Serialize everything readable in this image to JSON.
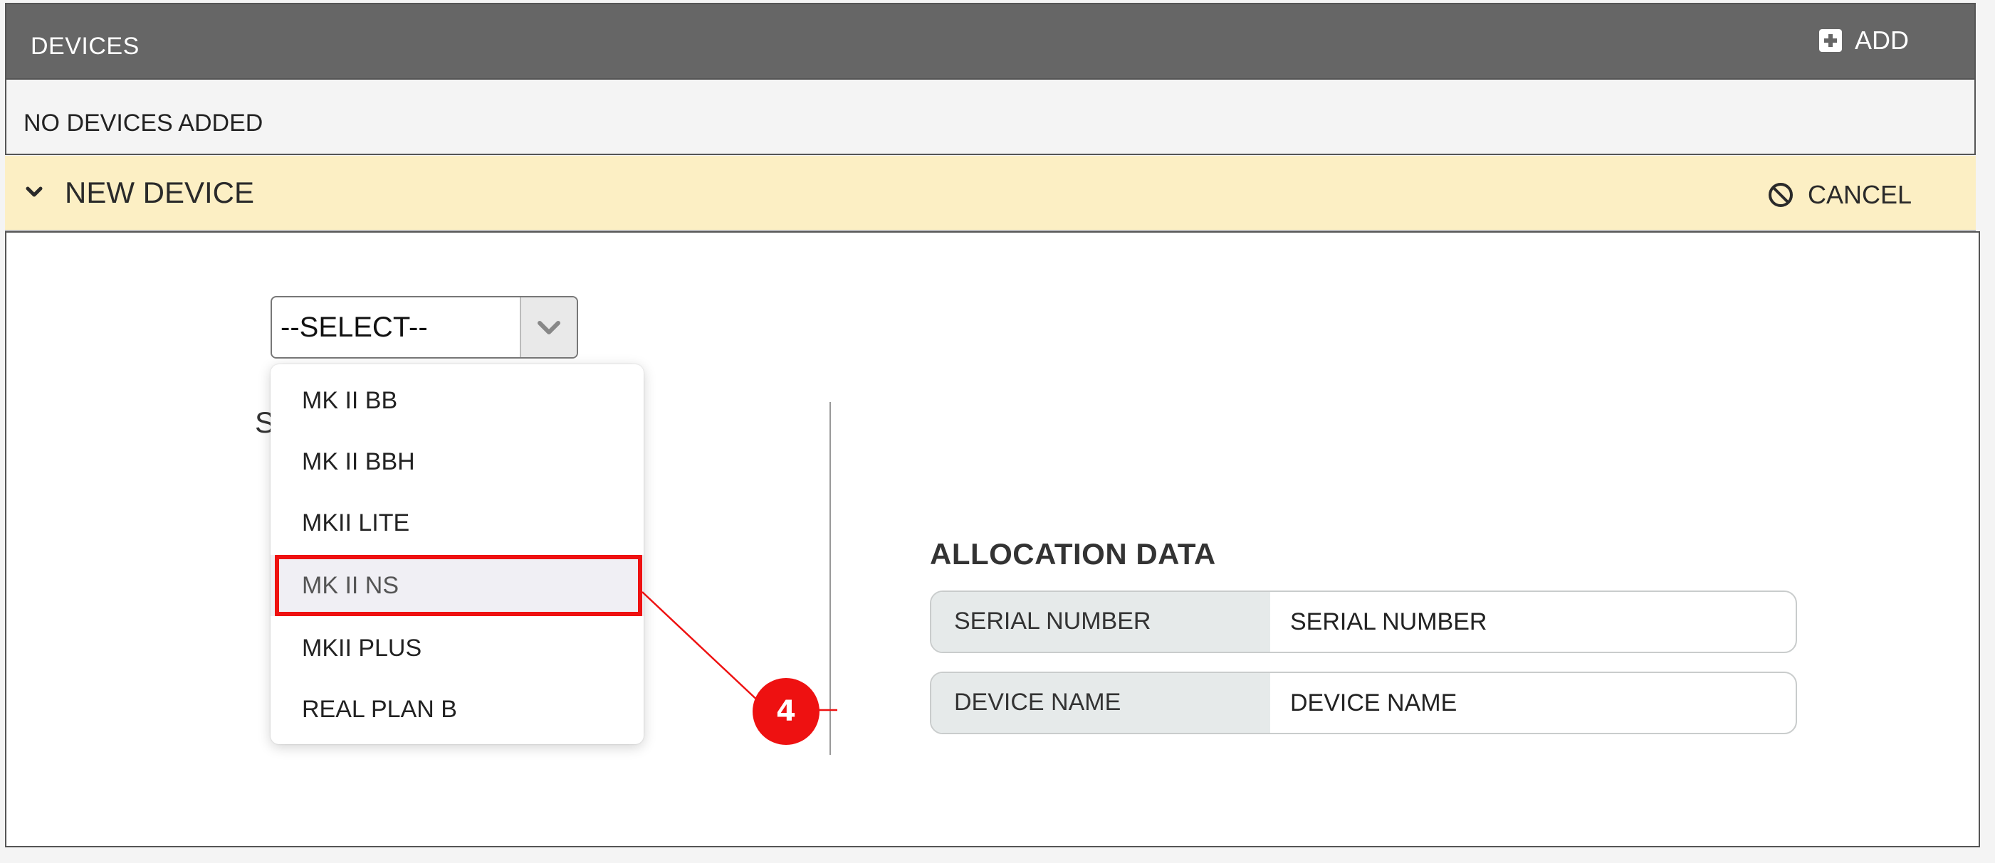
{
  "header": {
    "title": "DEVICES",
    "add_label": "ADD",
    "add_icon": "plus-square-icon"
  },
  "empty_state": {
    "text": "NO DEVICES ADDED"
  },
  "new_device": {
    "title": "NEW DEVICE",
    "cancel_label": "CANCEL",
    "collapse_icon": "chevron-down-icon",
    "cancel_icon": "ban-icon"
  },
  "device_select": {
    "value": "--SELECT--",
    "partial_label": "S",
    "options": [
      {
        "label": "MK II BB"
      },
      {
        "label": "MK II BBH"
      },
      {
        "label": "MKII LITE"
      },
      {
        "label": "MK II NS"
      },
      {
        "label": "MKII PLUS"
      },
      {
        "label": "REAL PLAN B"
      }
    ],
    "highlighted_option": "MK II NS"
  },
  "annotation": {
    "step_number": "4",
    "color": "#ee1111"
  },
  "allocation": {
    "title": "ALLOCATION DATA",
    "fields": [
      {
        "label": "SERIAL NUMBER",
        "placeholder": "SERIAL NUMBER"
      },
      {
        "label": "DEVICE NAME",
        "placeholder": "DEVICE NAME"
      }
    ]
  },
  "colors": {
    "header_bg": "#666666",
    "new_device_bg": "#fcefc4",
    "field_label_bg": "#e6eaea",
    "highlight": "#ee1111"
  }
}
